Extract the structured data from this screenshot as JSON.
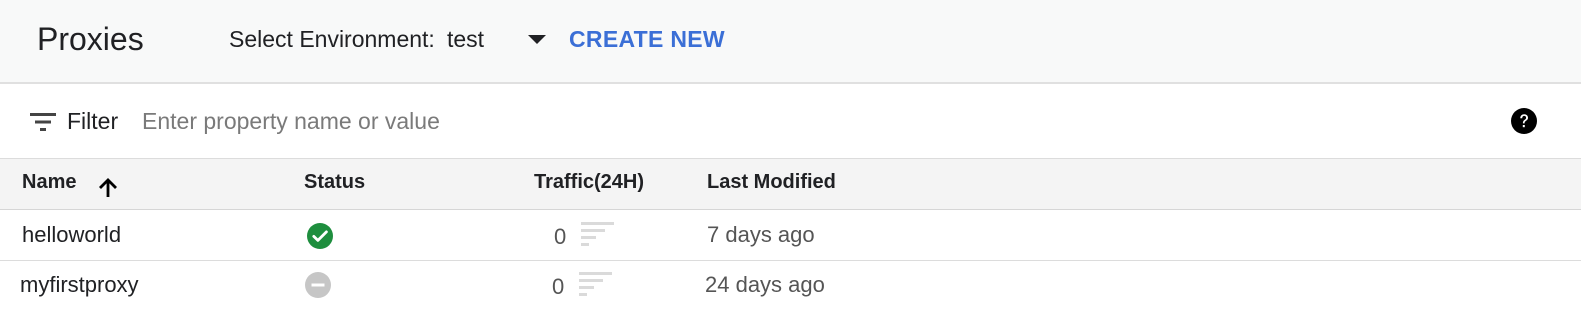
{
  "header": {
    "title": "Proxies",
    "environment_label": "Select Environment:",
    "environment_value": "test",
    "create_new_label": "CREATE NEW"
  },
  "filter": {
    "label": "Filter",
    "placeholder": "Enter property name or value",
    "icon": "filter-list-icon",
    "help_icon": "help-icon"
  },
  "table": {
    "columns": {
      "name": "Name",
      "status": "Status",
      "traffic": "Traffic(24H)",
      "last_modified": "Last Modified"
    },
    "sort": {
      "column": "Name",
      "direction": "ascending",
      "icon": "arrow-up-icon"
    },
    "rows": [
      {
        "name": "helloworld",
        "status": "deployed",
        "status_icon": "check-circle-icon",
        "status_color": "#1e8e3e",
        "traffic": "0",
        "last_modified": "7 days ago"
      },
      {
        "name": "myfirstproxy",
        "status": "not deployed",
        "status_icon": "minus-circle-icon",
        "status_color": "#c6c6c6",
        "traffic": "0",
        "last_modified": "24 days ago"
      }
    ]
  },
  "colors": {
    "accent": "#3b6fd6",
    "header_background": "#f8f9f9",
    "table_header_background": "#f4f4f4"
  }
}
